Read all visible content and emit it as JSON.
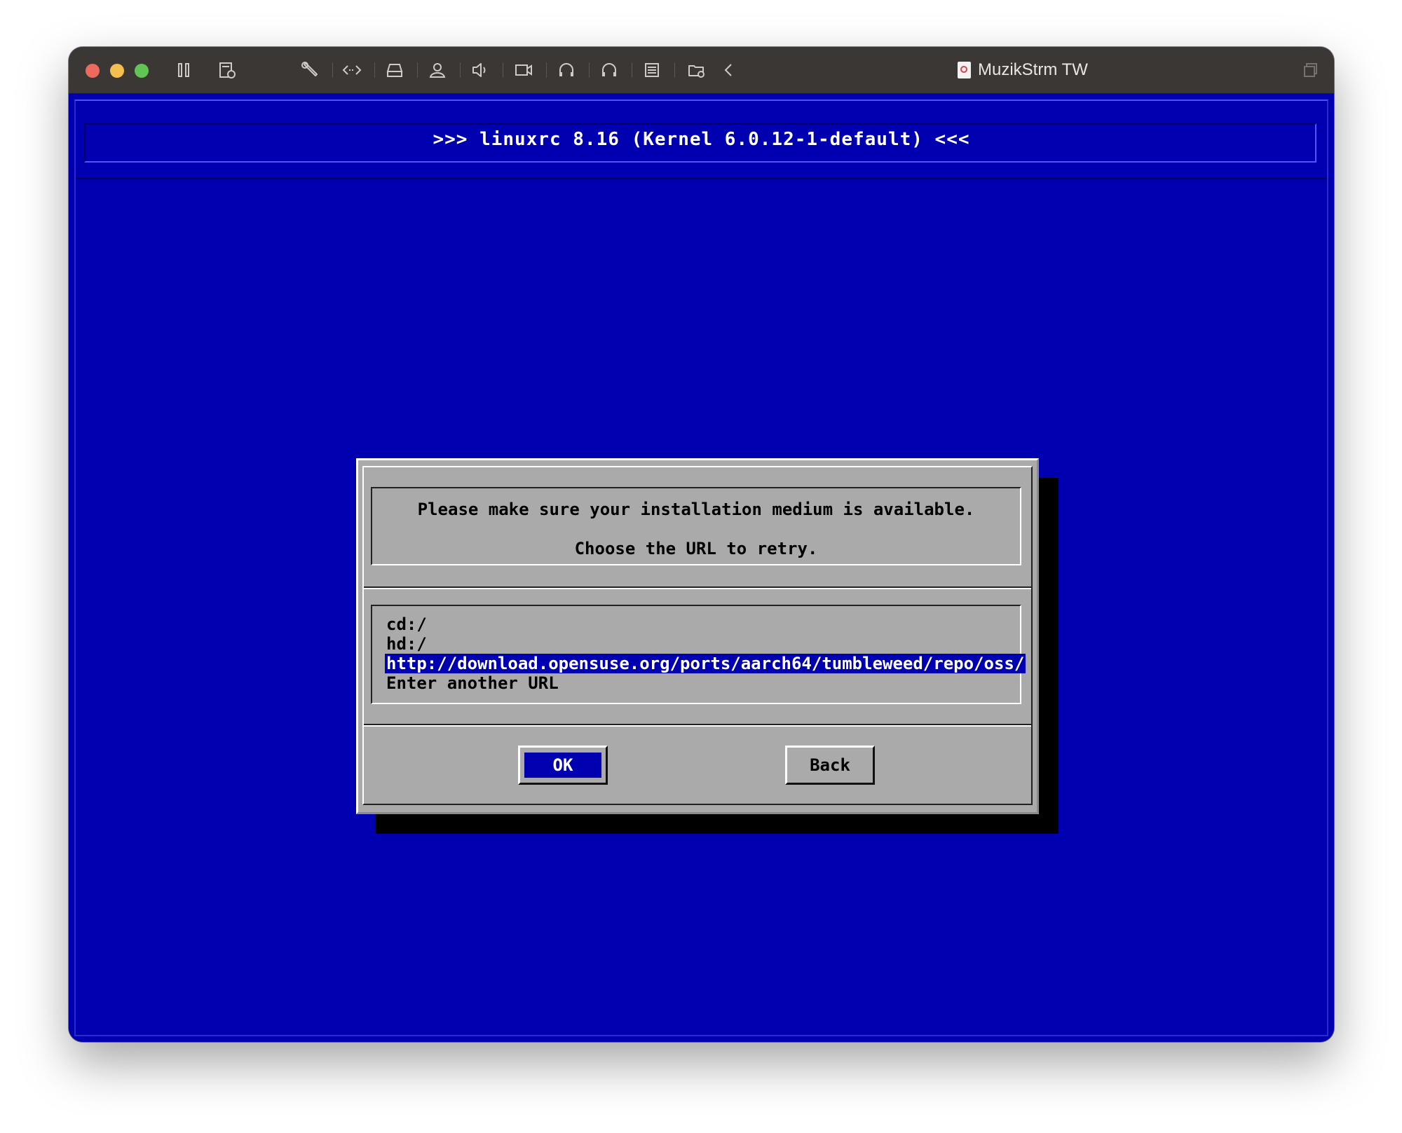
{
  "window": {
    "title": "MuzikStrm TW"
  },
  "toolbar": {
    "icons": [
      "pause-icon",
      "snapshot-icon",
      "settings-wrench-icon",
      "code-arrows-icon",
      "disk-icon",
      "user-icon",
      "speaker-icon",
      "camera-icon",
      "headphones-icon",
      "headset-icon",
      "list-icon",
      "shared-folder-icon",
      "back-chevron-icon",
      "window-icon"
    ]
  },
  "screen": {
    "header": ">>> linuxrc 8.16 (Kernel 6.0.12-1-default) <<<",
    "colors": {
      "background": "#0000b0",
      "dialog": "#aaaaaa",
      "selection": "#0000b0"
    }
  },
  "dialog": {
    "message_line1": "Please make sure your installation medium is available.",
    "message_line2": "Choose the URL to retry.",
    "items": [
      {
        "label": "cd:/",
        "selected": false
      },
      {
        "label": "hd:/",
        "selected": false
      },
      {
        "label": "http://download.opensuse.org/ports/aarch64/tumbleweed/repo/oss/",
        "selected": true
      },
      {
        "label": "Enter another URL",
        "selected": false
      }
    ],
    "ok_label": "OK",
    "back_label": "Back"
  }
}
